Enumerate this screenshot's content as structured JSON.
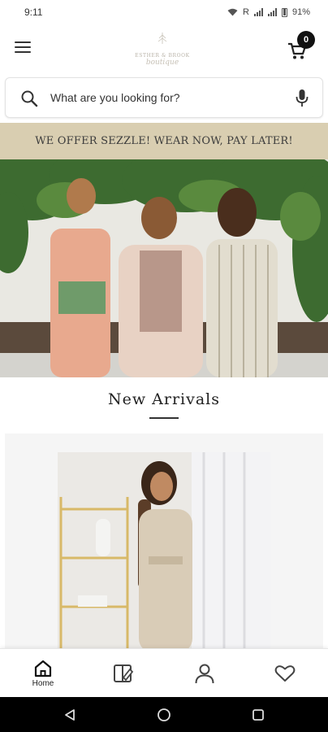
{
  "status_bar": {
    "time": "9:11",
    "carrier_indicator": "R",
    "battery_percent": "91%"
  },
  "header": {
    "logo_line1": "ESTHER & BROOK",
    "logo_line2": "boutique",
    "cart_count": "0"
  },
  "search": {
    "placeholder": "What are you looking for?"
  },
  "promo": {
    "text": "WE OFFER SEZZLE! WEAR NOW, PAY LATER!"
  },
  "new_arrivals": {
    "title": "New Arrivals"
  },
  "bottom_nav": {
    "items": [
      {
        "label": "Home",
        "icon": "home-icon",
        "active": true
      },
      {
        "label": "",
        "icon": "collections-icon",
        "active": false
      },
      {
        "label": "",
        "icon": "account-icon",
        "active": false
      },
      {
        "label": "",
        "icon": "wishlist-icon",
        "active": false
      }
    ]
  },
  "colors": {
    "promo_bg": "#d9ceb1",
    "cart_badge": "#111111",
    "system_nav": "#000000"
  }
}
